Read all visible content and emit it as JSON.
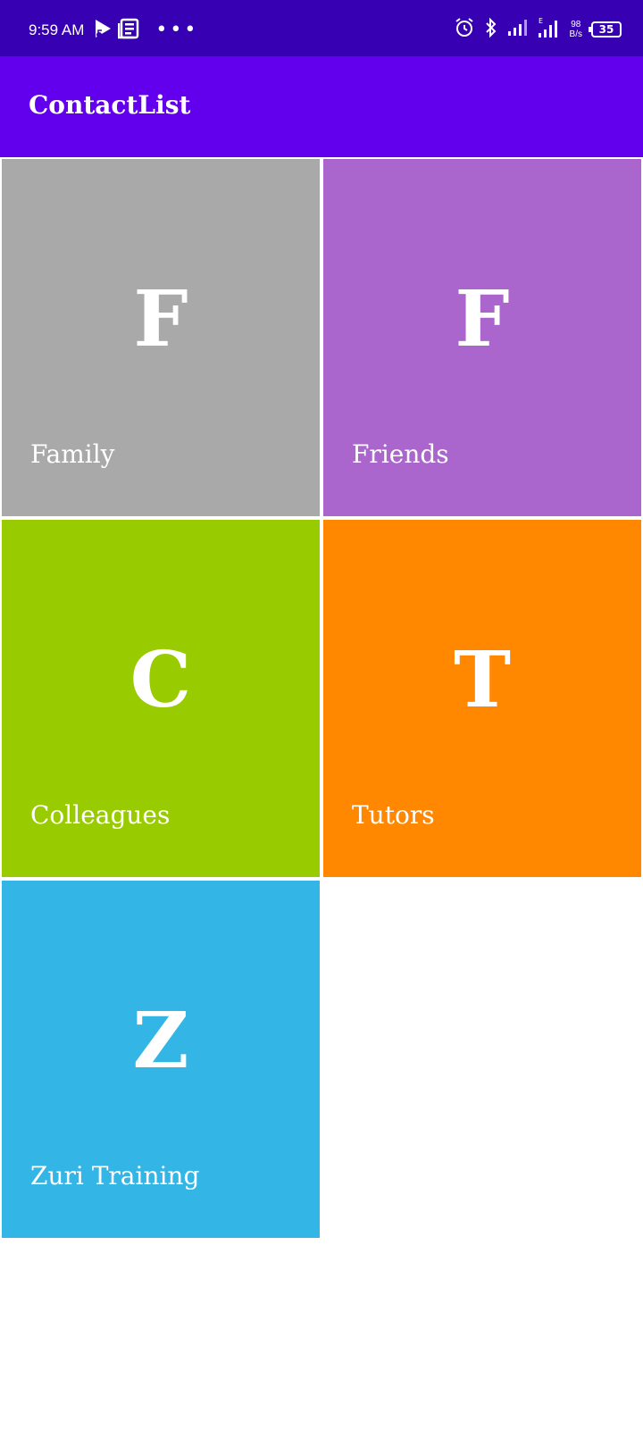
{
  "status_bar": {
    "time": "9:59 AM",
    "icons_left": [
      "play-store-icon",
      "news-icon"
    ],
    "dots": "•••",
    "icons_right": [
      "alarm-icon",
      "bluetooth-icon",
      "signal-icon",
      "signal-e-icon"
    ],
    "net_speed_top": "98",
    "net_speed_bottom": "B/s",
    "battery": "35"
  },
  "app_bar": {
    "title": "ContactList",
    "color": "#6200ee"
  },
  "groups": [
    {
      "letter": "F",
      "label": "Family",
      "color": "#a9a9a9"
    },
    {
      "letter": "F",
      "label": "Friends",
      "color": "#aa66cc"
    },
    {
      "letter": "C",
      "label": "Colleagues",
      "color": "#99cc00"
    },
    {
      "letter": "T",
      "label": "Tutors",
      "color": "#ff8800"
    },
    {
      "letter": "Z",
      "label": "Zuri Training",
      "color": "#33b5e5"
    }
  ]
}
